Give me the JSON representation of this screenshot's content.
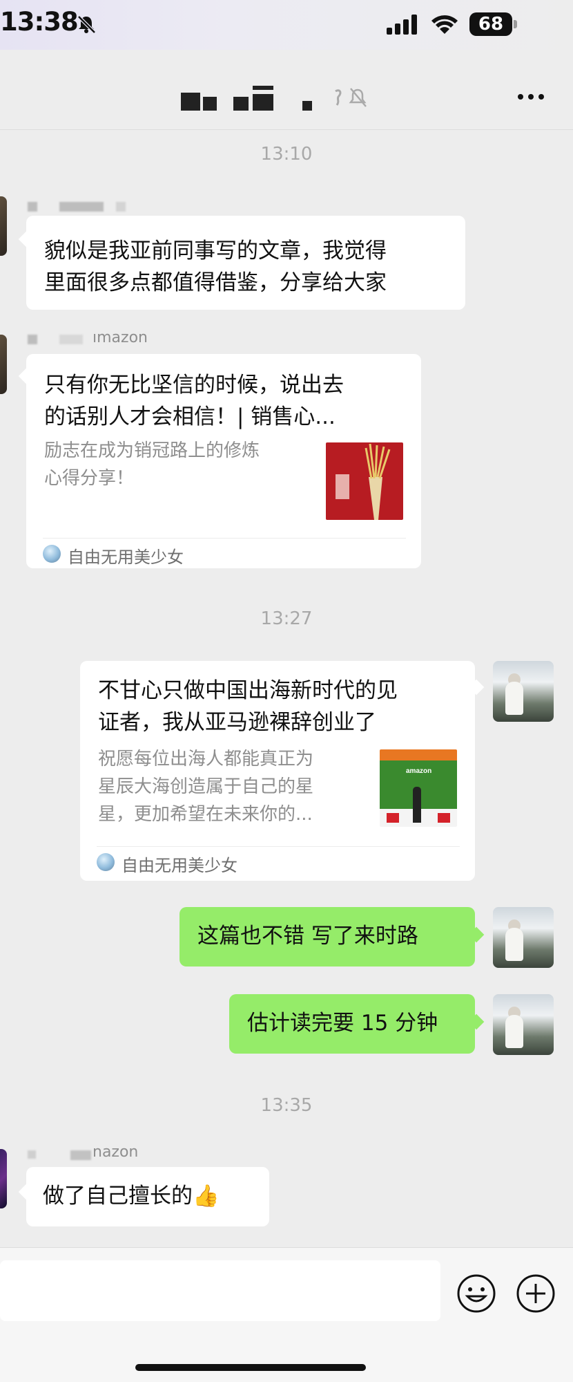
{
  "status_bar": {
    "time": "13:38",
    "battery": "68"
  },
  "nav": {
    "more_icon": "more-horizontal-icon"
  },
  "timestamps": [
    "13:10",
    "13:27",
    "13:35"
  ],
  "messages": {
    "m1": {
      "text_line1": "貌似是我亚前同事写的文章，我觉得",
      "text_line2": "里面很多点都值得借鉴，分享给大家"
    },
    "m2": {
      "sender_suffix": "ımazon",
      "title_line1": "只有你无比坚信的时候，说出去",
      "title_line2": "的话别人才会相信！| 销售心...",
      "desc_line1": "励志在成为销冠路上的修炼",
      "desc_line2": "心得分享！",
      "source": "自由无用美少女"
    },
    "m3": {
      "title_line1": "不甘心只做中国出海新时代的见",
      "title_line2": "证者，我从亚马逊裸辞创业了",
      "desc_line1": "祝愿每位出海人都能真正为",
      "desc_line2": "星辰大海创造属于自己的星",
      "desc_line3": "星，更加希望在未来你的...",
      "thumb_text": "amazon",
      "source": "自由无用美少女"
    },
    "m4": {
      "text": "这篇也不错 写了来时路"
    },
    "m5": {
      "text": "估计读完要 15 分钟"
    },
    "m6": {
      "sender_suffix": "nazon",
      "text": "做了自己擅长的👍"
    }
  },
  "colors": {
    "background": "#ededed",
    "green_bubble": "#95ec69",
    "timestamp": "#a8a8a8"
  }
}
